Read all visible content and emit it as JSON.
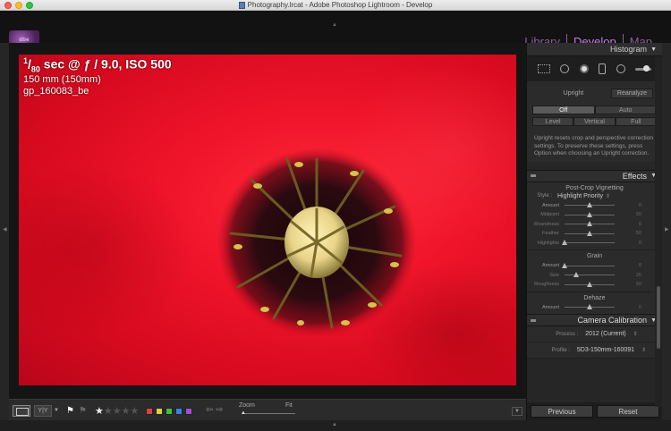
{
  "window": {
    "title": "Photography.lrcat - Adobe Photoshop Lightroom - Develop"
  },
  "modules": {
    "library": "Library",
    "develop": "Develop",
    "map": "Map"
  },
  "photo": {
    "exif_denominator": "80",
    "exif_rest": " sec @ ƒ / 9.0, ISO 500",
    "focal": "150 mm (150mm)",
    "filename": "gp_160083_be"
  },
  "toolbar": {
    "zoom_label": "Zoom",
    "fit_label": "Fit",
    "view_toggle": "Y|Y",
    "color_labels": [
      "#e04040",
      "#e0d040",
      "#40c040",
      "#4080e0",
      "#a050d0"
    ]
  },
  "panel": {
    "histogram_title": "Histogram",
    "upright_label": "Upright",
    "reanalyze": "Reanalyze",
    "off": "Off",
    "auto": "Auto",
    "level": "Level",
    "vertical": "Vertical",
    "full": "Full",
    "upright_desc": "Upright resets crop and perspective correction settings. To preserve these settings, press Option when choosing an Upright correction.",
    "effects_title": "Effects",
    "vignette_title": "Post-Crop Vignetting",
    "style_label": "Style :",
    "style_value": "Highlight Priority",
    "vignette_sliders": [
      {
        "label": "Amount",
        "value": "0"
      },
      {
        "label": "Midpoint",
        "value": "50"
      },
      {
        "label": "Roundness",
        "value": "0"
      },
      {
        "label": "Feather",
        "value": "50"
      },
      {
        "label": "Highlights",
        "value": "0"
      }
    ],
    "grain_title": "Grain",
    "grain_sliders": [
      {
        "label": "Amount",
        "value": "0"
      },
      {
        "label": "Size",
        "value": "25"
      },
      {
        "label": "Roughness",
        "value": "50"
      }
    ],
    "dehaze_title": "Dehaze",
    "dehaze_sliders": [
      {
        "label": "Amount",
        "value": "0"
      }
    ],
    "camera_cal_title": "Camera Calibration",
    "process_label": "Process :",
    "process_value": "2012 (Current)",
    "profile_label": "Profile :",
    "profile_value": "5D3-150mm-160091",
    "previous": "Previous",
    "reset": "Reset"
  }
}
